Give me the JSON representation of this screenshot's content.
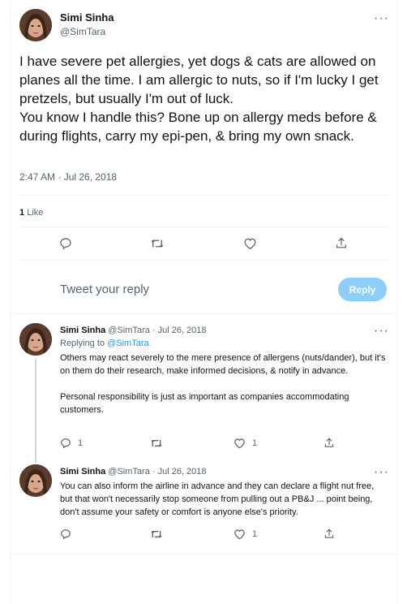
{
  "main_tweet": {
    "author_name": "Simi Sinha",
    "author_handle": "@SimTara",
    "text": "I have severe pet allergies, yet dogs & cats are allowed on planes all the time. I am allergic to nuts, so if I'm lucky I get pretzels, but usually I'm out of luck.\nYou know I handle this? Bone up on allergy meds before & during flights, carry my epi-pen, & bring my own snack.",
    "timestamp": "2:47 AM · Jul 26, 2018",
    "like_count": "1",
    "like_label": "Like",
    "more_label": "···"
  },
  "reply_box": {
    "placeholder": "Tweet your reply",
    "button_label": "Reply"
  },
  "replies": [
    {
      "author_name": "Simi Sinha",
      "meta": " @SimTara · Jul 26, 2018",
      "replying_prefix": "Replying to ",
      "replying_handle": "@SimTara",
      "text": "Others may react severely to the mere presence of allergens (nuts/dander), but it's on them do their research, make informed decisions, & notify in advance.\n\nPersonal responsibility is just as important as companies accommodating customers.",
      "reply_count": "1",
      "like_count": "1",
      "more_label": "···"
    },
    {
      "author_name": "Simi Sinha",
      "meta": " @SimTara · Jul 26, 2018",
      "text": "You can also inform the airline in advance and they can declare a flight nut free, but that won't necessarily stop someone from pulling out a PB&J ... point being, don't assume your safety or comfort is anyone else's priority.",
      "reply_count": "",
      "like_count": "1",
      "more_label": "···"
    }
  ],
  "icons": [
    "avatar",
    "reply-icon",
    "retweet-icon",
    "like-icon",
    "share-icon",
    "more-icon"
  ]
}
